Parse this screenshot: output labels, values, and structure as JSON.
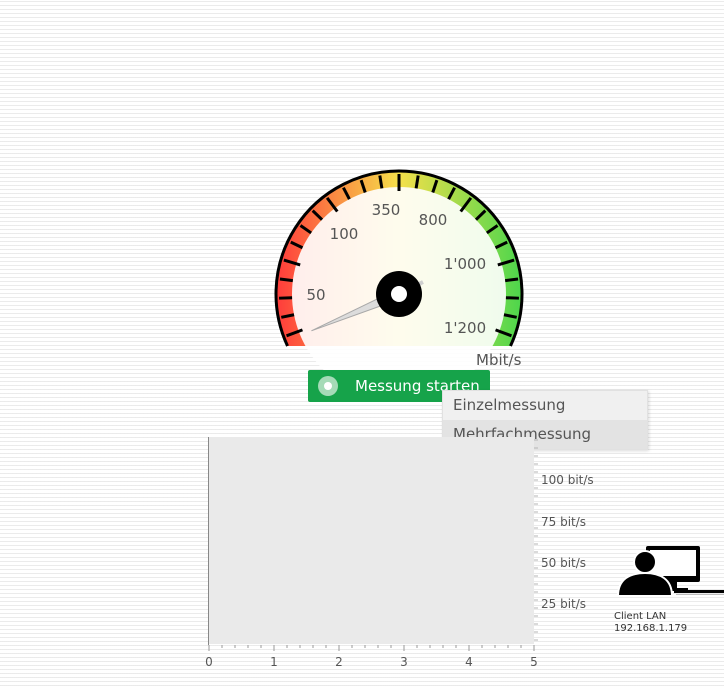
{
  "gauge": {
    "unit": "Mbit/s",
    "tick_labels": [
      "50",
      "100",
      "350",
      "800",
      "1'000",
      "1'200"
    ],
    "needle_value": "50"
  },
  "actions": {
    "start_label": "Messung starten",
    "menu": {
      "single": "Einzelmessung",
      "multiple": "Mehrfachmessung"
    }
  },
  "chart_data": {
    "type": "line",
    "x_ticks": [
      "0",
      "1",
      "2",
      "3",
      "4",
      "5"
    ],
    "y_ticks": [
      "25 bit/s",
      "50 bit/s",
      "75 bit/s",
      "100 bit/s"
    ],
    "series": [],
    "xlim": [
      0,
      5
    ],
    "ylim": [
      0,
      125
    ]
  },
  "client": {
    "label": "Client LAN",
    "ip": "192.168.1.179"
  },
  "colors": {
    "button": "#16a34a",
    "gauge_low": "#ff3b3b",
    "gauge_mid": "#f5e04a",
    "gauge_high": "#4cd64c"
  }
}
